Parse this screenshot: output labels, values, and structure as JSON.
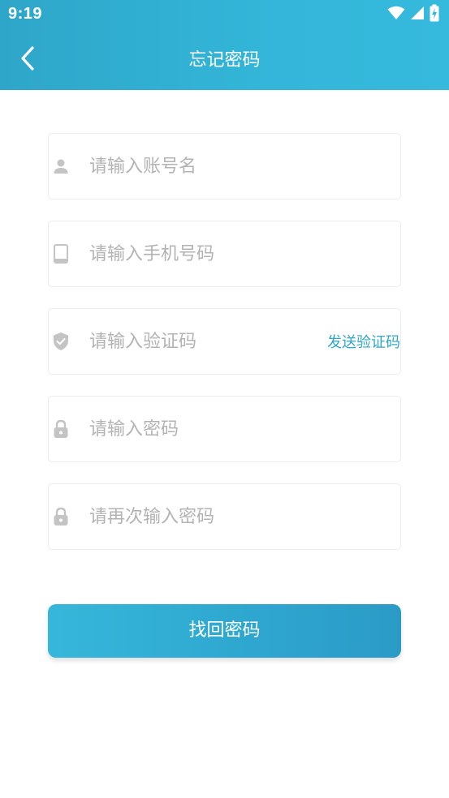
{
  "status_bar": {
    "time": "9:19"
  },
  "header": {
    "title": "忘记密码"
  },
  "form": {
    "account": {
      "placeholder": "请输入账号名",
      "value": ""
    },
    "phone": {
      "placeholder": "请输入手机号码",
      "value": ""
    },
    "code": {
      "placeholder": "请输入验证码",
      "value": "",
      "send_label": "发送验证码"
    },
    "password": {
      "placeholder": "请输入密码",
      "value": ""
    },
    "confirm_password": {
      "placeholder": "请再次输入密码",
      "value": ""
    }
  },
  "actions": {
    "submit_label": "找回密码"
  },
  "icons": {
    "back": "chevron-left-icon",
    "account": "person-icon",
    "phone": "phone-icon",
    "code": "shield-check-icon",
    "password": "lock-icon",
    "confirm_password": "lock-icon",
    "wifi": "wifi-icon",
    "signal": "signal-icon",
    "battery": "battery-charging-icon"
  },
  "colors": {
    "brand": "#33b6d9",
    "link": "#2ea6c9",
    "placeholder": "#b3b3b3",
    "icon": "#c4c4c4"
  }
}
